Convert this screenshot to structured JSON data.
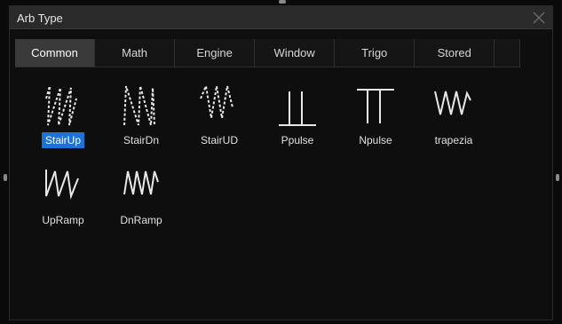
{
  "dialog": {
    "title": "Arb Type",
    "close_icon": "close-icon"
  },
  "tabs": [
    {
      "label": "Common",
      "active": true
    },
    {
      "label": "Math",
      "active": false
    },
    {
      "label": "Engine",
      "active": false
    },
    {
      "label": "Window",
      "active": false
    },
    {
      "label": "Trigo",
      "active": false
    },
    {
      "label": "Stored",
      "active": false
    }
  ],
  "waveforms": [
    {
      "label": "StairUp",
      "icon": "stairup-wave-icon",
      "selected": true
    },
    {
      "label": "StairDn",
      "icon": "stairdn-wave-icon",
      "selected": false
    },
    {
      "label": "StairUD",
      "icon": "stairud-wave-icon",
      "selected": false
    },
    {
      "label": "Ppulse",
      "icon": "ppulse-wave-icon",
      "selected": false
    },
    {
      "label": "Npulse",
      "icon": "npulse-wave-icon",
      "selected": false
    },
    {
      "label": "trapezia",
      "icon": "trapezia-wave-icon",
      "selected": false
    },
    {
      "label": "UpRamp",
      "icon": "upramp-wave-icon",
      "selected": false
    },
    {
      "label": "DnRamp",
      "icon": "dnramp-wave-icon",
      "selected": false
    }
  ],
  "colors": {
    "selection": "#1d72d8",
    "active_tab": "#3a3a3a",
    "title_bar": "#2a2a2a"
  }
}
